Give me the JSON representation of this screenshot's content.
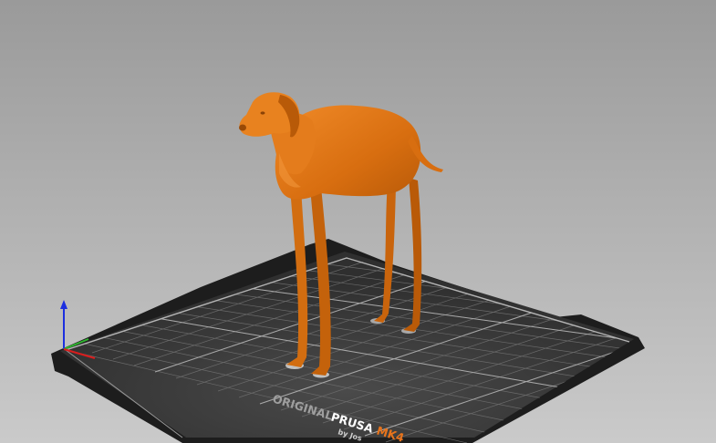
{
  "viewport": {
    "background_top": "#9c9c9c",
    "background_bottom": "#c9c9c9"
  },
  "bed": {
    "brand_prefix": "ORIGINAL",
    "brand_main": "PRUSA",
    "brand_model": "MK4",
    "byline": "by Jos",
    "surface_color": "#333333",
    "grid_color": "#8a8a8a",
    "accent_color": "#e8741c"
  },
  "model": {
    "icon": "dog-figurine-icon",
    "color": "#e07614"
  },
  "axes": {
    "x_color": "#d81d1d",
    "y_color": "#2fb52f",
    "z_color": "#1c2fe0"
  }
}
